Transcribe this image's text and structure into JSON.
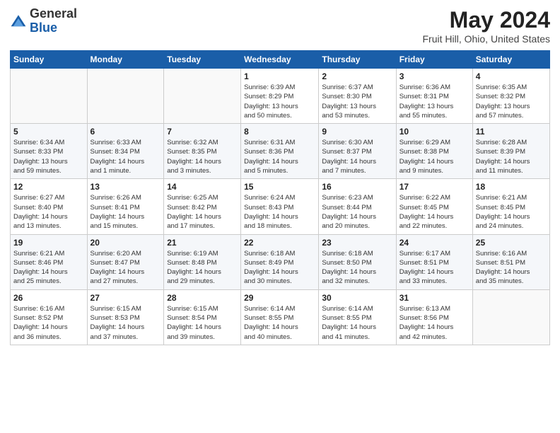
{
  "logo": {
    "general": "General",
    "blue": "Blue"
  },
  "header": {
    "title": "May 2024",
    "subtitle": "Fruit Hill, Ohio, United States"
  },
  "weekdays": [
    "Sunday",
    "Monday",
    "Tuesday",
    "Wednesday",
    "Thursday",
    "Friday",
    "Saturday"
  ],
  "weeks": [
    [
      {
        "day": "",
        "info": ""
      },
      {
        "day": "",
        "info": ""
      },
      {
        "day": "",
        "info": ""
      },
      {
        "day": "1",
        "info": "Sunrise: 6:39 AM\nSunset: 8:29 PM\nDaylight: 13 hours\nand 50 minutes."
      },
      {
        "day": "2",
        "info": "Sunrise: 6:37 AM\nSunset: 8:30 PM\nDaylight: 13 hours\nand 53 minutes."
      },
      {
        "day": "3",
        "info": "Sunrise: 6:36 AM\nSunset: 8:31 PM\nDaylight: 13 hours\nand 55 minutes."
      },
      {
        "day": "4",
        "info": "Sunrise: 6:35 AM\nSunset: 8:32 PM\nDaylight: 13 hours\nand 57 minutes."
      }
    ],
    [
      {
        "day": "5",
        "info": "Sunrise: 6:34 AM\nSunset: 8:33 PM\nDaylight: 13 hours\nand 59 minutes."
      },
      {
        "day": "6",
        "info": "Sunrise: 6:33 AM\nSunset: 8:34 PM\nDaylight: 14 hours\nand 1 minute."
      },
      {
        "day": "7",
        "info": "Sunrise: 6:32 AM\nSunset: 8:35 PM\nDaylight: 14 hours\nand 3 minutes."
      },
      {
        "day": "8",
        "info": "Sunrise: 6:31 AM\nSunset: 8:36 PM\nDaylight: 14 hours\nand 5 minutes."
      },
      {
        "day": "9",
        "info": "Sunrise: 6:30 AM\nSunset: 8:37 PM\nDaylight: 14 hours\nand 7 minutes."
      },
      {
        "day": "10",
        "info": "Sunrise: 6:29 AM\nSunset: 8:38 PM\nDaylight: 14 hours\nand 9 minutes."
      },
      {
        "day": "11",
        "info": "Sunrise: 6:28 AM\nSunset: 8:39 PM\nDaylight: 14 hours\nand 11 minutes."
      }
    ],
    [
      {
        "day": "12",
        "info": "Sunrise: 6:27 AM\nSunset: 8:40 PM\nDaylight: 14 hours\nand 13 minutes."
      },
      {
        "day": "13",
        "info": "Sunrise: 6:26 AM\nSunset: 8:41 PM\nDaylight: 14 hours\nand 15 minutes."
      },
      {
        "day": "14",
        "info": "Sunrise: 6:25 AM\nSunset: 8:42 PM\nDaylight: 14 hours\nand 17 minutes."
      },
      {
        "day": "15",
        "info": "Sunrise: 6:24 AM\nSunset: 8:43 PM\nDaylight: 14 hours\nand 18 minutes."
      },
      {
        "day": "16",
        "info": "Sunrise: 6:23 AM\nSunset: 8:44 PM\nDaylight: 14 hours\nand 20 minutes."
      },
      {
        "day": "17",
        "info": "Sunrise: 6:22 AM\nSunset: 8:45 PM\nDaylight: 14 hours\nand 22 minutes."
      },
      {
        "day": "18",
        "info": "Sunrise: 6:21 AM\nSunset: 8:45 PM\nDaylight: 14 hours\nand 24 minutes."
      }
    ],
    [
      {
        "day": "19",
        "info": "Sunrise: 6:21 AM\nSunset: 8:46 PM\nDaylight: 14 hours\nand 25 minutes."
      },
      {
        "day": "20",
        "info": "Sunrise: 6:20 AM\nSunset: 8:47 PM\nDaylight: 14 hours\nand 27 minutes."
      },
      {
        "day": "21",
        "info": "Sunrise: 6:19 AM\nSunset: 8:48 PM\nDaylight: 14 hours\nand 29 minutes."
      },
      {
        "day": "22",
        "info": "Sunrise: 6:18 AM\nSunset: 8:49 PM\nDaylight: 14 hours\nand 30 minutes."
      },
      {
        "day": "23",
        "info": "Sunrise: 6:18 AM\nSunset: 8:50 PM\nDaylight: 14 hours\nand 32 minutes."
      },
      {
        "day": "24",
        "info": "Sunrise: 6:17 AM\nSunset: 8:51 PM\nDaylight: 14 hours\nand 33 minutes."
      },
      {
        "day": "25",
        "info": "Sunrise: 6:16 AM\nSunset: 8:51 PM\nDaylight: 14 hours\nand 35 minutes."
      }
    ],
    [
      {
        "day": "26",
        "info": "Sunrise: 6:16 AM\nSunset: 8:52 PM\nDaylight: 14 hours\nand 36 minutes."
      },
      {
        "day": "27",
        "info": "Sunrise: 6:15 AM\nSunset: 8:53 PM\nDaylight: 14 hours\nand 37 minutes."
      },
      {
        "day": "28",
        "info": "Sunrise: 6:15 AM\nSunset: 8:54 PM\nDaylight: 14 hours\nand 39 minutes."
      },
      {
        "day": "29",
        "info": "Sunrise: 6:14 AM\nSunset: 8:55 PM\nDaylight: 14 hours\nand 40 minutes."
      },
      {
        "day": "30",
        "info": "Sunrise: 6:14 AM\nSunset: 8:55 PM\nDaylight: 14 hours\nand 41 minutes."
      },
      {
        "day": "31",
        "info": "Sunrise: 6:13 AM\nSunset: 8:56 PM\nDaylight: 14 hours\nand 42 minutes."
      },
      {
        "day": "",
        "info": ""
      }
    ]
  ]
}
